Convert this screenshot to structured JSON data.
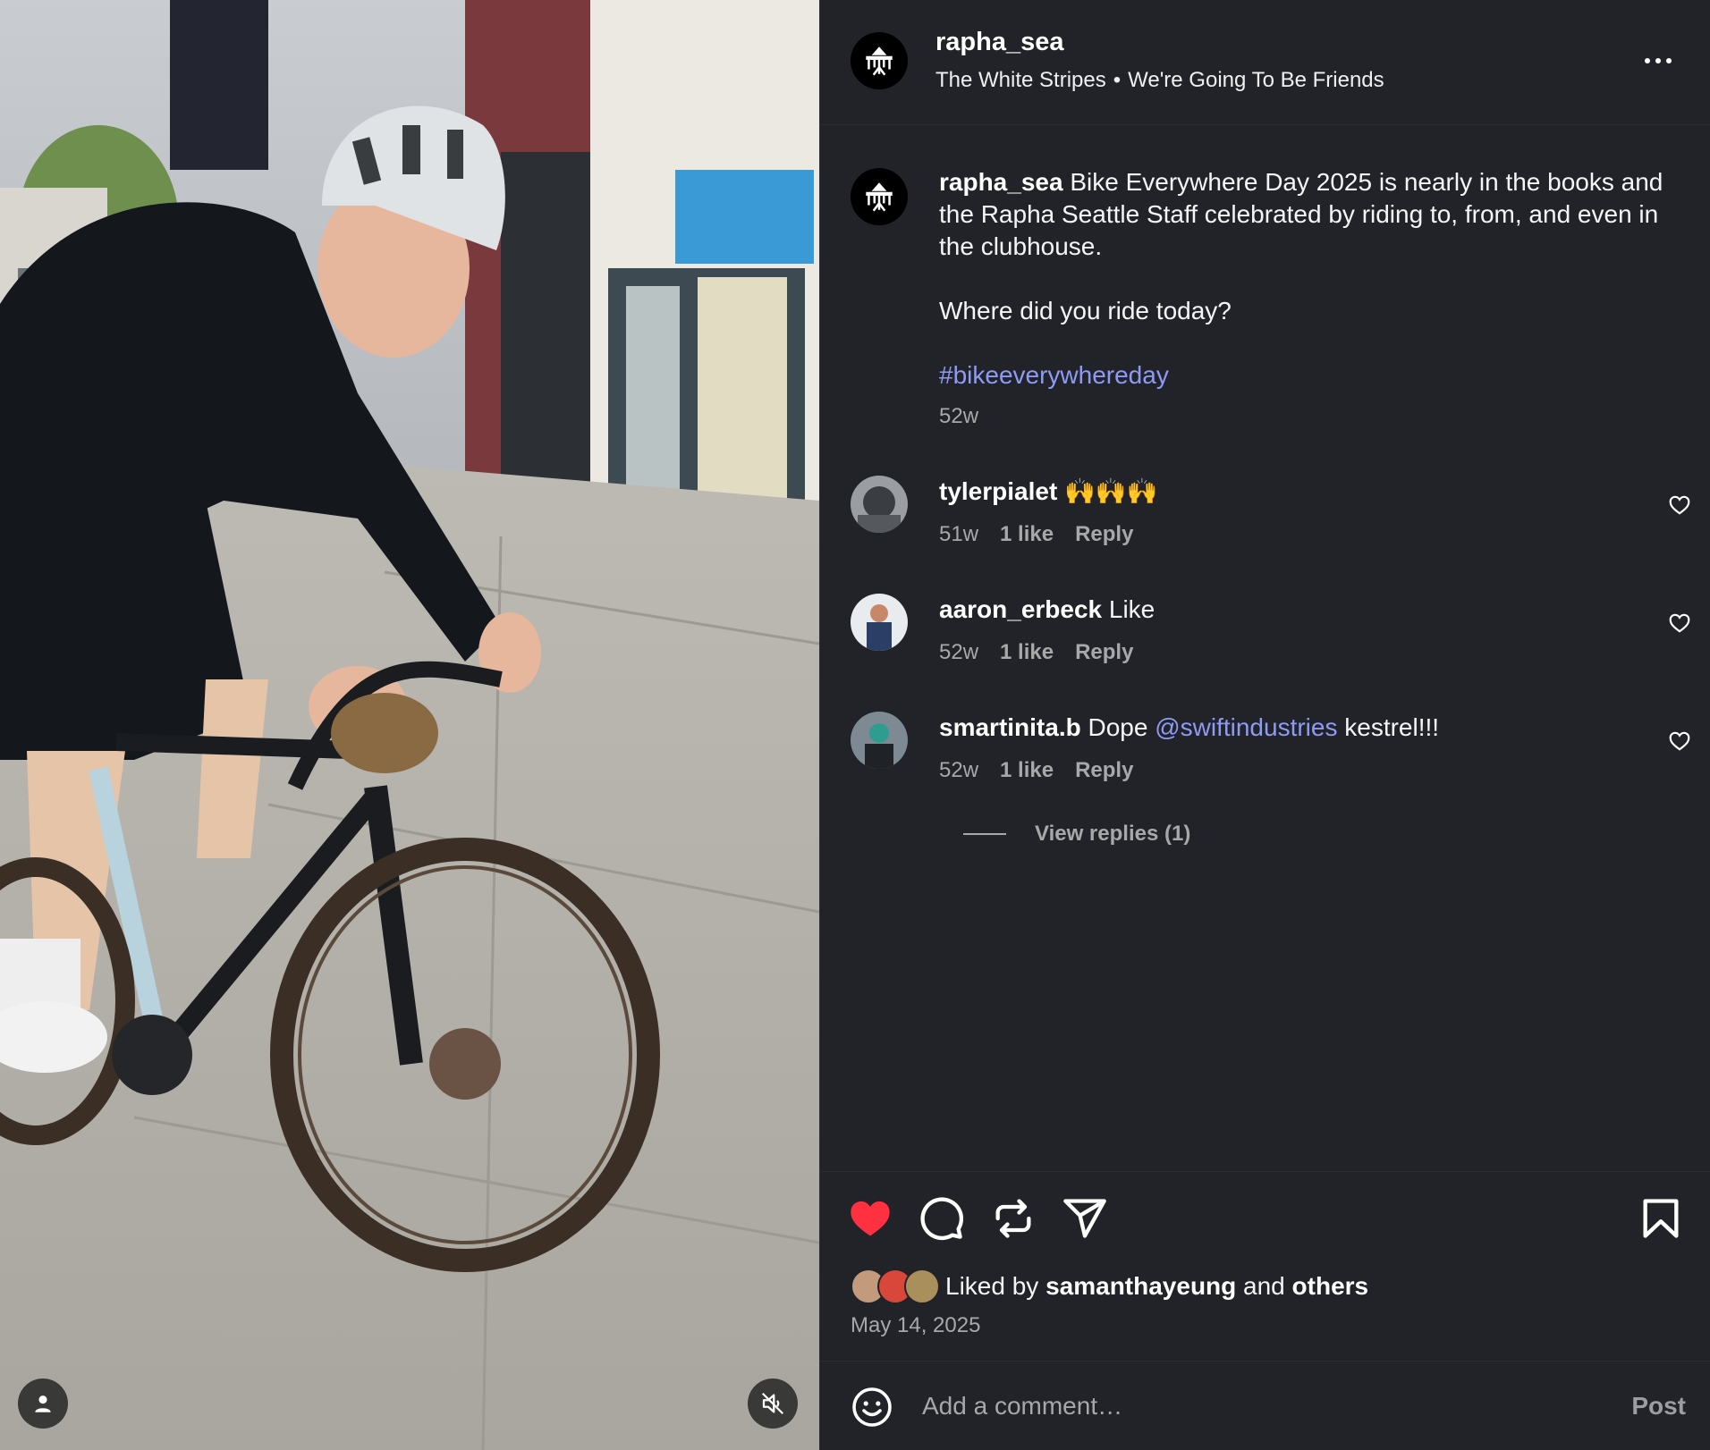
{
  "post": {
    "username": "rapha_sea",
    "audio_artist": "The White Stripes",
    "audio_separator": "•",
    "audio_track": "We're Going To Be Friends"
  },
  "caption": {
    "username": "rapha_sea",
    "text": "Bike Everywhere Day 2025 is nearly in the books and the Rapha Seattle Staff celebrated by riding to, from, and even in the clubhouse.",
    "question": "Where did you ride today?",
    "hashtag": "#bikeeverywhereday",
    "time": "52w"
  },
  "comments": [
    {
      "username": "tylerpialet",
      "text": "🙌🙌🙌",
      "mention": "",
      "text_after": "",
      "time": "51w",
      "likes": "1 like",
      "reply": "Reply"
    },
    {
      "username": "aaron_erbeck",
      "text": "Like",
      "mention": "",
      "text_after": "",
      "time": "52w",
      "likes": "1 like",
      "reply": "Reply"
    },
    {
      "username": "smartinita.b",
      "text": "Dope",
      "mention": "@swiftindustries",
      "text_after": "kestrel!!!",
      "time": "52w",
      "likes": "1 like",
      "reply": "Reply"
    }
  ],
  "view_replies": "View replies (1)",
  "likes": {
    "prefix": "Liked by",
    "user": "samanthayeung",
    "and": "and",
    "others": "others",
    "liked": true
  },
  "date": "May 14, 2025",
  "composer": {
    "placeholder": "Add a comment…",
    "post_label": "Post"
  },
  "colors": {
    "background": "#212328",
    "link": "#8e9bf5",
    "like_red": "#ff3040",
    "muted": "#a8a8a8"
  },
  "icons": [
    "user-tag-icon",
    "muted-speaker-icon",
    "more-icon",
    "heart-icon",
    "comment-icon",
    "repost-icon",
    "share-icon",
    "bookmark-icon",
    "emoji-icon"
  ]
}
